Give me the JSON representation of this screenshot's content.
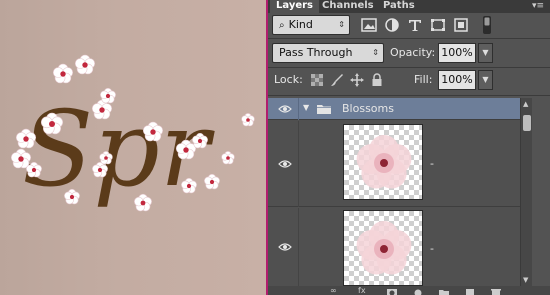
{
  "canvas": {
    "word": "Spr",
    "background": "#c3aca2",
    "text_color": "#5b3b1a",
    "blossom_color": "#ffffff",
    "blossom_center": "#c2283e"
  },
  "panel": {
    "tabs": [
      {
        "label": "Layers",
        "active": true
      },
      {
        "label": "Channels",
        "active": false
      },
      {
        "label": "Paths",
        "active": false
      }
    ],
    "menu_icon": "panel-menu-icon",
    "filter": {
      "kind_label": "Kind",
      "icons": [
        "pixel-filter-icon",
        "adjustment-filter-icon",
        "type-filter-icon",
        "shape-filter-icon",
        "smart-object-filter-icon",
        "filter-toggle-icon"
      ]
    },
    "blend": {
      "mode": "Pass Through",
      "opacity_label": "Opacity:",
      "opacity_value": "100%"
    },
    "lock": {
      "label": "Lock:",
      "icons": [
        "lock-transparent-icon",
        "lock-paint-icon",
        "lock-move-icon",
        "lock-all-icon"
      ],
      "fill_label": "Fill:",
      "fill_value": "100%"
    },
    "layers": [
      {
        "name": "Blossoms",
        "type": "group",
        "visible": true,
        "expanded": true
      },
      {
        "name": "-",
        "type": "layer",
        "visible": true
      },
      {
        "name": "-",
        "type": "layer",
        "visible": true
      }
    ],
    "accent": "#6d7e99",
    "border_color": "#b11e6e",
    "bottom_icons": [
      "link-layers-icon",
      "fx-icon",
      "add-mask-icon",
      "adjustment-icon",
      "new-group-icon",
      "new-layer-icon",
      "delete-icon"
    ]
  }
}
